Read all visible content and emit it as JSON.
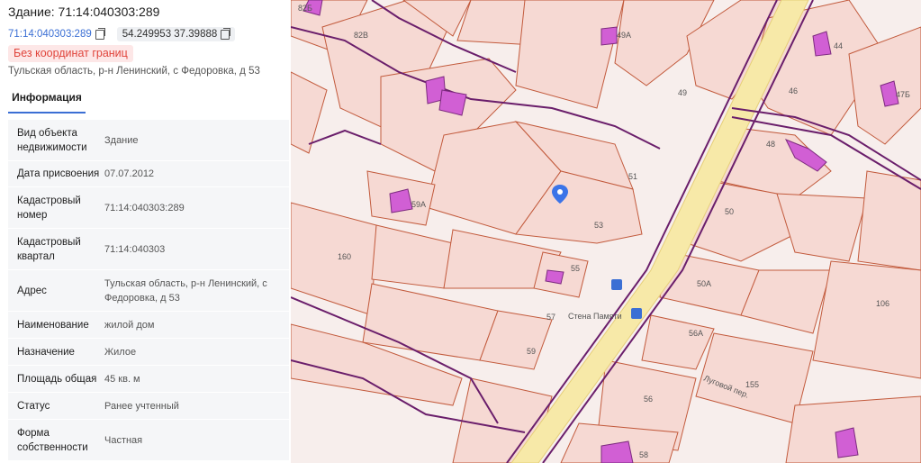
{
  "header": {
    "title": "Здание: 71:14:040303:289",
    "cad_link": "71:14:040303:289",
    "coords": "54.249953 37.39888",
    "badge": "Без координат границ",
    "address": "Тульская область, р-н Ленинский, с Федоровка, д 53"
  },
  "tabs": {
    "info": "Информация"
  },
  "info": [
    {
      "key": "Вид объекта недвижимости",
      "value": "Здание"
    },
    {
      "key": "Дата присвоения",
      "value": "07.07.2012"
    },
    {
      "key": "Кадастровый номер",
      "value": "71:14:040303:289"
    },
    {
      "key": "Кадастровый квартал",
      "value": "71:14:040303"
    },
    {
      "key": "Адрес",
      "value": "Тульская область, р-н Ленинский, с Федоровка, д 53"
    },
    {
      "key": "Наименование",
      "value": "жилой дом"
    },
    {
      "key": "Назначение",
      "value": "Жилое"
    },
    {
      "key": "Площадь общая",
      "value": "45  кв. м"
    },
    {
      "key": "Статус",
      "value": "Ранее учтенный"
    },
    {
      "key": "Форма собственности",
      "value": "Частная"
    }
  ],
  "map": {
    "labels": {
      "l82b": "82Б",
      "l82v": "82В",
      "l49a": "49А",
      "l49": "49",
      "l44": "44",
      "l46": "46",
      "l47b": "47Б",
      "l48": "48",
      "l51": "51",
      "l53": "53",
      "l50": "50",
      "l59a": "59А",
      "l160": "160",
      "l55": "55",
      "l57": "57",
      "l50a": "50А",
      "l106": "106",
      "l56a": "56А",
      "l59": "59",
      "l155": "155",
      "l56": "56",
      "l58": "58",
      "street": "Луговой пер.",
      "poi": "Стена Памяти"
    },
    "colors": {
      "parcel_fill": "#f6d9d3",
      "parcel_line": "#c25a3c",
      "quarter_line": "#6a1e6b",
      "building": "#d15fd4",
      "road": "#f7e9a8",
      "marker": "#3b74e8"
    }
  }
}
